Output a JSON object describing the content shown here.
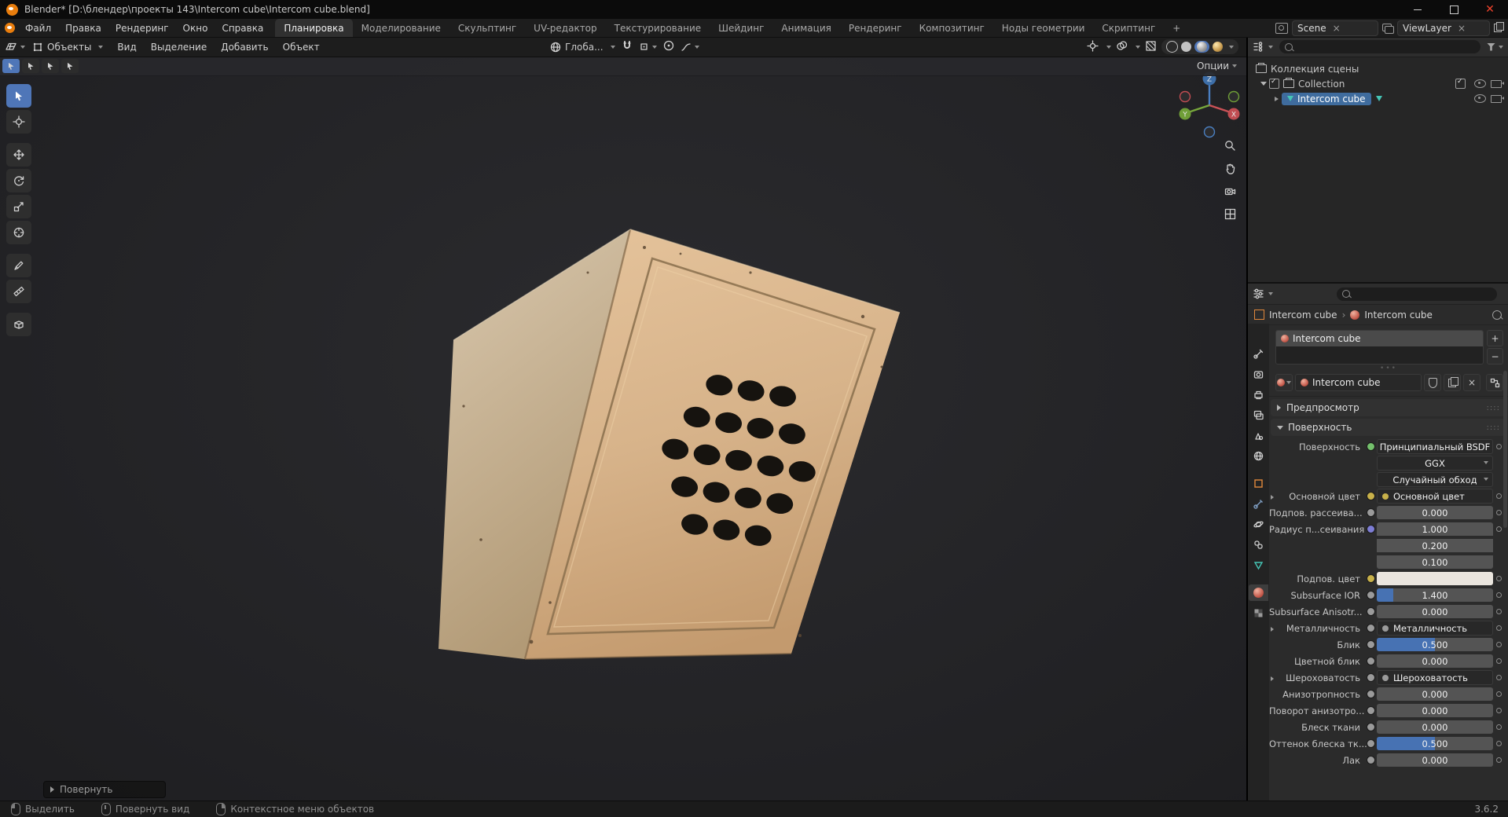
{
  "window": {
    "title": "Blender* [D:\\блендер\\проекты 143\\Intercom cube\\Intercom cube.blend]"
  },
  "topbar": {
    "menus": [
      "Файл",
      "Правка",
      "Рендеринг",
      "Окно",
      "Справка"
    ],
    "workspaces": [
      "Планировка",
      "Моделирование",
      "Скульптинг",
      "UV-редактор",
      "Текстурирование",
      "Шейдинг",
      "Анимация",
      "Рендеринг",
      "Композитинг",
      "Ноды геометрии",
      "Скриптинг"
    ],
    "add_workspace": "+",
    "scene": "Scene",
    "viewlayer": "ViewLayer"
  },
  "viewport": {
    "header": {
      "mode": "Объекты",
      "menu_view": "Вид",
      "menu_select": "Выделение",
      "menu_add": "Добавить",
      "menu_object": "Объект",
      "orientation": "Глоба..."
    },
    "toolsettings_options": "Опции",
    "operator": "Повернуть",
    "gizmo_axes": {
      "x": "X",
      "y": "Y",
      "z": "Z"
    }
  },
  "outliner": {
    "scene_collection": "Коллекция сцены",
    "collection": "Collection",
    "object": "Intercom cube"
  },
  "properties": {
    "breadcrumb_object": "Intercom cube",
    "breadcrumb_material": "Intercom cube",
    "slot": "Intercom cube",
    "material": "Intercom cube",
    "slot_add": "+",
    "slot_remove": "−",
    "preview": "Предпросмотр",
    "surface": "Поверхность",
    "rows": [
      {
        "label": "Поверхность",
        "value": "Принципиальный BSDF"
      },
      {
        "label": "",
        "value": "GGX"
      },
      {
        "label": "",
        "value": "Случайный обход"
      },
      {
        "label": "Основной цвет",
        "value": "Основной цвет"
      },
      {
        "label": "Подпов. рассеива...",
        "value": "0.000"
      },
      {
        "label": "Радиус п...сеивания",
        "value": "1.000"
      },
      {
        "label": "",
        "value": "0.200"
      },
      {
        "label": "",
        "value": "0.100"
      },
      {
        "label": "Подпов. цвет",
        "value": ""
      },
      {
        "label": "Subsurface IOR",
        "value": "1.400"
      },
      {
        "label": "Subsurface Anisotr...",
        "value": "0.000"
      },
      {
        "label": "Металличность",
        "value": "Металличность"
      },
      {
        "label": "Блик",
        "value": "0.500"
      },
      {
        "label": "Цветной блик",
        "value": "0.000"
      },
      {
        "label": "Шероховатость",
        "value": "Шероховатость"
      },
      {
        "label": "Анизотропность",
        "value": "0.000"
      },
      {
        "label": "Поворот анизотро...",
        "value": "0.000"
      },
      {
        "label": "Блеск ткани",
        "value": "0.000"
      },
      {
        "label": "Оттенок блеска тк...",
        "value": "0.500"
      },
      {
        "label": "Лак",
        "value": "0.000"
      }
    ]
  },
  "statusbar": {
    "select": "Выделить",
    "rotate_view": "Повернуть вид",
    "context_menu": "Контекстное меню объектов",
    "version": "3.6.2"
  },
  "colors": {
    "accent": "#4772b3",
    "selection": "#3f6c9e",
    "object_tan": "#d6b289"
  }
}
